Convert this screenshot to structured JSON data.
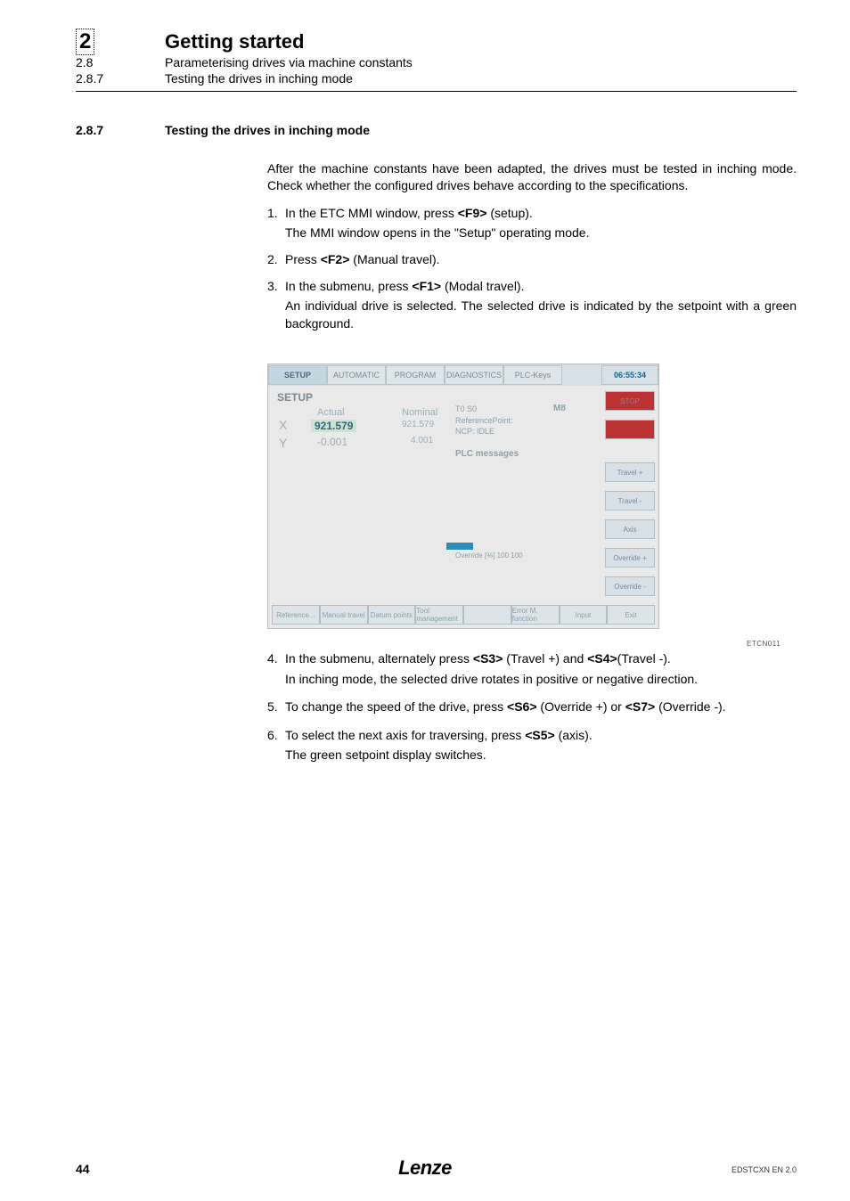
{
  "header": {
    "chapter_num": "2",
    "chapter_title": "Getting started",
    "sub1_num": "2.8",
    "sub1_text": "Parameterising drives via machine constants",
    "sub2_num": "2.8.7",
    "sub2_text": "Testing the drives in inching mode"
  },
  "section": {
    "num": "2.8.7",
    "title": "Testing the drives in inching mode"
  },
  "intro": "After the machine constants have been adapted, the drives must be tested in inching mode. Check whether the configured drives behave according to the specifications.",
  "steps_top": [
    {
      "num": "1.",
      "text": "In the ETC MMI window, press <F9> (setup).",
      "detail": "The MMI window opens in the \"Setup\" operating mode."
    },
    {
      "num": "2.",
      "text": "Press <F2> (Manual travel).",
      "detail": ""
    },
    {
      "num": "3.",
      "text": "In the submenu, press <F1> (Modal travel).",
      "detail": "An individual drive is selected. The selected drive is indicated by the setpoint with a green background."
    }
  ],
  "screenshot": {
    "tabs": [
      "SETUP",
      "AUTOMATIC",
      "PROGRAM",
      "DIAGNOSTICS",
      "PLC-Keys"
    ],
    "time": "06:55:34",
    "setup_label": "SETUP",
    "actual_label": "Actual",
    "nominal_label": "Nominal",
    "x_label": "X",
    "y_label": "Y",
    "x_actual": "921.579",
    "x_nominal": "921.579",
    "y_actual": "-0.001",
    "y_nominal": "4.001",
    "right_info_1": "T0                 S0",
    "right_info_2": "ReferencePoint:",
    "right_info_3": "NCP: IDLE",
    "m8": "M8",
    "plc": "PLC messages",
    "override": "Override [%]       100             100",
    "right_buttons": [
      "STOP",
      "",
      "Travel +",
      "Travel -",
      "Axis",
      "Override +",
      "Override -"
    ],
    "bottom_row": [
      "Reference...",
      "Manual travel",
      "Datum points",
      "Tool management",
      "",
      "Error M. function",
      "Input",
      "Exit"
    ]
  },
  "img_code": "ETCN011",
  "steps_bottom": [
    {
      "num": "4.",
      "text": "In the submenu, alternately press <S3> (Travel +) and <S4>(Travel -).",
      "detail": "In inching mode, the selected drive rotates in positive or negative direction."
    },
    {
      "num": "5.",
      "text": "To change the speed of the drive, press <S6> (Override +) or <S7> (Override -).",
      "detail": ""
    },
    {
      "num": "6.",
      "text": "To select the next axis for traversing, press <S5> (axis).",
      "detail": "The green setpoint display switches."
    }
  ],
  "footer": {
    "page": "44",
    "logo": "Lenze",
    "code": "EDSTCXN EN 2.0"
  }
}
